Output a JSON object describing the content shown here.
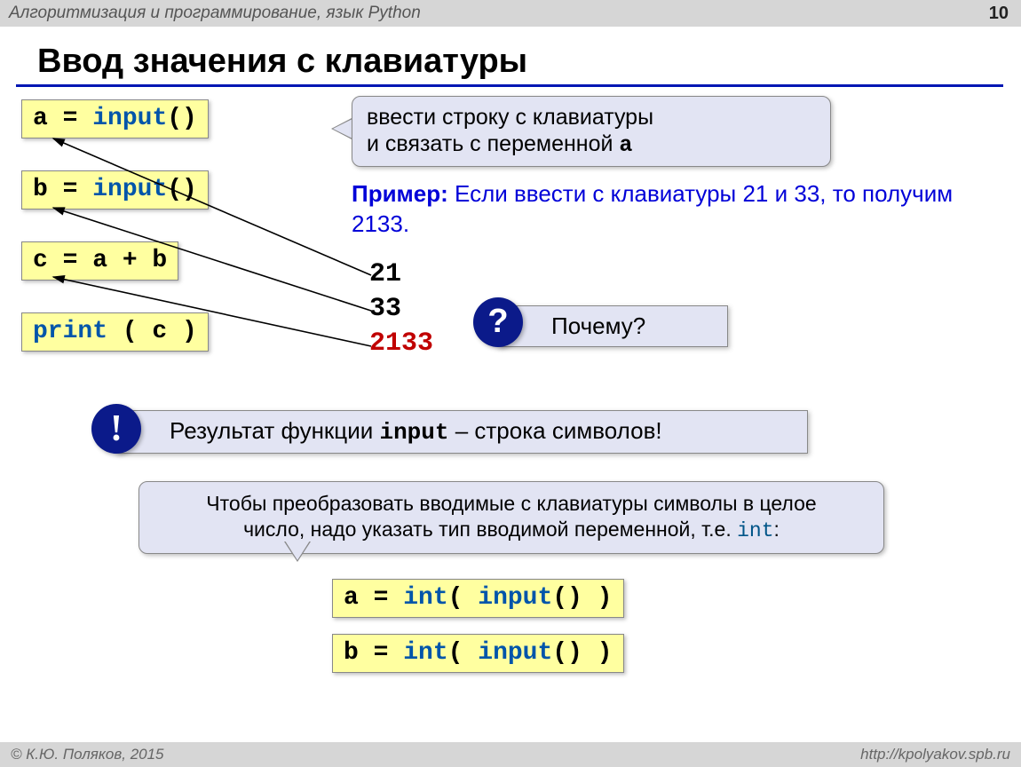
{
  "header": {
    "course": "Алгоритмизация и программирование,  язык Python",
    "page": "10"
  },
  "title": "Ввод значения с клавиатуры",
  "code": {
    "line1_a": "a",
    "line1_eq": " = ",
    "line1_kw": "input",
    "line1_par": "()",
    "line2_a": "b",
    "line2_eq": " = ",
    "line2_kw": "input",
    "line2_par": "()",
    "line3": "c = a + b",
    "line4_kw": "print",
    "line4_rest": " ( c )"
  },
  "bubble1": {
    "l1": "ввести строку с клавиатуры",
    "l2_a": "и связать с переменной ",
    "l2_b": "a"
  },
  "example": {
    "label": "Пример:",
    "text": " Если ввести с клавиатуры 21 и 33, то получим 2133."
  },
  "output": {
    "v1": "21",
    "v2": "33",
    "v3": "2133"
  },
  "why_box": "Почему?",
  "result_box": {
    "pre": "Результат функции ",
    "mono": "input",
    "post": " – строка символов!"
  },
  "tip": {
    "l1": "Чтобы преобразовать вводимые с клавиатуры символы в целое",
    "l2_a": "число, надо указать тип вводимой переменной, т.е. ",
    "l2_b": "int",
    "l2_c": ":"
  },
  "code2": {
    "a_pre": "a",
    "a_eq": " = ",
    "a_kw1": "int",
    "a_mid": "( ",
    "a_kw2": "input",
    "a_post": "() )",
    "b_pre": "b",
    "b_eq": " = ",
    "b_kw1": "int",
    "b_mid": "( ",
    "b_kw2": "input",
    "b_post": "() )"
  },
  "footer": {
    "left": "© К.Ю. Поляков, 2015",
    "right": "http://kpolyakov.spb.ru"
  }
}
